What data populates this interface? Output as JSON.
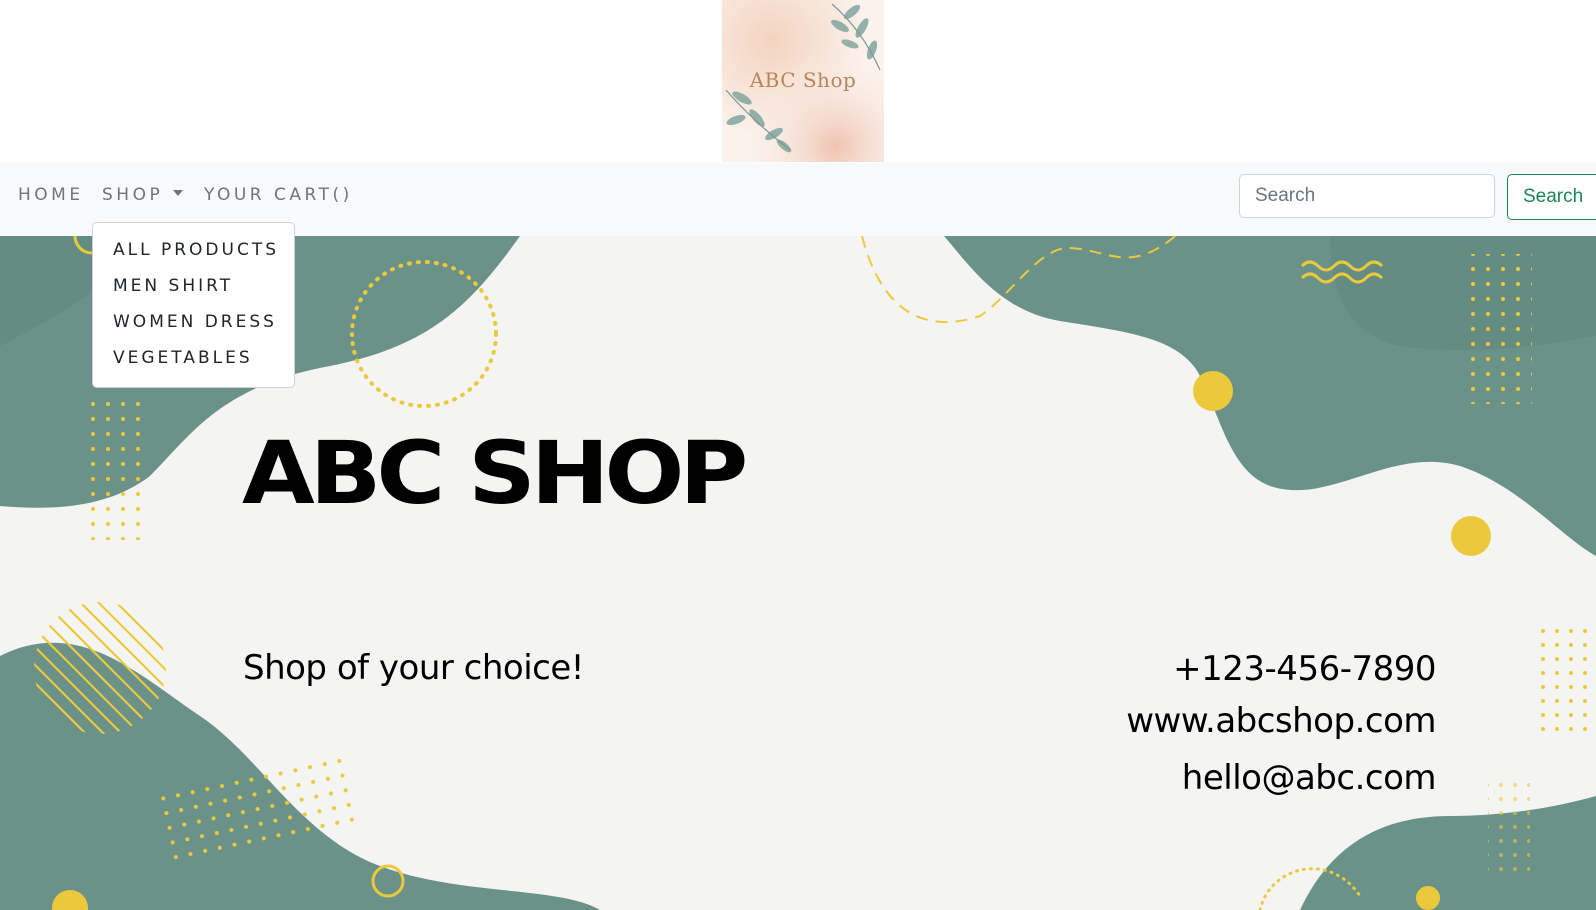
{
  "logo": {
    "text": "ABC Shop"
  },
  "nav": {
    "home": "HOME",
    "shop": "SHOP",
    "cart": "YOUR CART()"
  },
  "dropdown": {
    "items": [
      "ALL PRODUCTS",
      "MEN SHIRT",
      "WOMEN DRESS",
      "VEGETABLES"
    ]
  },
  "search": {
    "placeholder": "Search",
    "value": "",
    "button_label": "Search"
  },
  "hero": {
    "title": "ABC SHOP",
    "tagline": "Shop of your choice!",
    "phone": "+123-456-7890",
    "website": "www.abcshop.com",
    "email": "hello@abc.com"
  },
  "colors": {
    "teal": "#6a9289",
    "yellow": "#ecc93c",
    "success": "#198754",
    "navbar_bg": "#f8f9fa"
  }
}
